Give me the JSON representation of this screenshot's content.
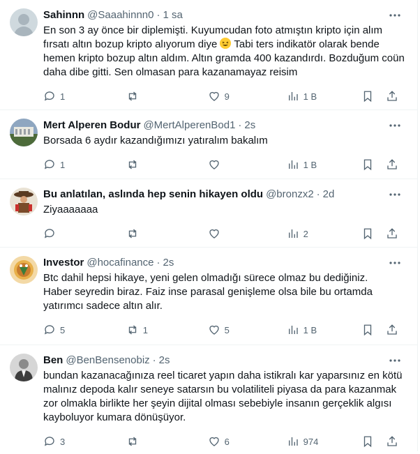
{
  "tweets": [
    {
      "name": "Sahinnn",
      "handle": "@Saaahinnn0",
      "time": "1 sa",
      "text_before_emoji": "En son 3 ay önce bir diplemişti. Kuyumcudan foto atmıştın kripto için alım fırsatı altın bozup kripto alıyorum diye ",
      "emoji": "laughing-face",
      "text_after_emoji": " Tabi ters indikatör olarak bende hemen kripto bozup altın aldım. Altın gramda 400 kazandırdı. Bozduğum coün daha dibe gitti. Sen olmasan para kazanamayaz reisim",
      "replies": "1",
      "retweets": "",
      "likes": "9",
      "views": "1 B"
    },
    {
      "name": "Mert Alperen Bodur",
      "handle": "@MertAlperenBod1",
      "time": "2s",
      "text": "Borsada 6 aydır kazandığımızı yatıralım bakalım",
      "replies": "1",
      "retweets": "",
      "likes": "",
      "views": "1 B"
    },
    {
      "name": "Bu anlatılan, aslında hep senin hikayen oldu",
      "handle": "@bronzx2",
      "time": "2d",
      "text": "Ziyaaaaaaa",
      "replies": "",
      "retweets": "",
      "likes": "",
      "views": "2"
    },
    {
      "name": "Investor",
      "handle": "@hocafinance",
      "time": "2s",
      "text": "Btc dahil hepsi hikaye, yeni gelen olmadığı sürece olmaz bu dediğiniz.\nHaber seyredin biraz. Faiz inse parasal genişleme olsa bile bu ortamda yatırımcı sadece altın alır.",
      "replies": "5",
      "retweets": "1",
      "likes": "5",
      "views": "1 B"
    },
    {
      "name": "Ben",
      "handle": "@BenBensenobiz",
      "time": "2s",
      "text": "bundan kazanacağınıza reel ticaret yapın daha istikralı kar yaparsınız en kötü malınız depoda kalır seneye satarsın bu volatiliteli piyasa da para kazanmak zor olmakla birlikte her şeyin dijital olması sebebiyle insanın gerçeklik algısı kayboluyor kumara dönüşüyor.",
      "replies": "3",
      "retweets": "",
      "likes": "6",
      "views": "974"
    }
  ],
  "colors": {
    "text": "#0f1419",
    "secondary": "#536471",
    "border": "#eff3f4"
  }
}
